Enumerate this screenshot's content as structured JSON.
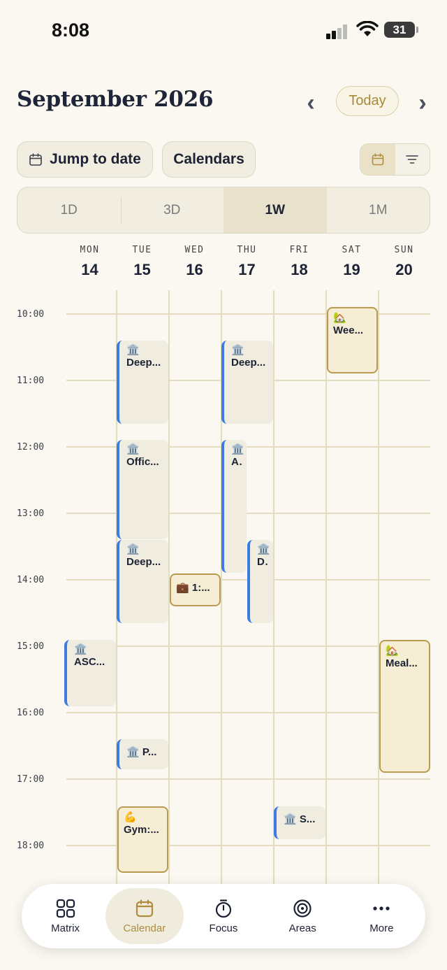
{
  "status": {
    "time": "8:08",
    "battery": "31"
  },
  "header": {
    "title": "September 2026",
    "today_label": "Today",
    "prev": "‹",
    "next": "›"
  },
  "toolbar": {
    "jump_label": "Jump to date",
    "calendars_label": "Calendars"
  },
  "range": {
    "options": [
      "1D",
      "3D",
      "1W",
      "1M"
    ],
    "selected": "1W"
  },
  "days": [
    {
      "dow": "MON",
      "num": "14"
    },
    {
      "dow": "TUE",
      "num": "15"
    },
    {
      "dow": "WED",
      "num": "16"
    },
    {
      "dow": "THU",
      "num": "17"
    },
    {
      "dow": "FRI",
      "num": "18"
    },
    {
      "dow": "SAT",
      "num": "19"
    },
    {
      "dow": "SUN",
      "num": "20"
    }
  ],
  "hours": [
    "10:00",
    "11:00",
    "12:00",
    "13:00",
    "14:00",
    "15:00",
    "16:00",
    "17:00",
    "18:00"
  ],
  "events": {
    "sat_wee": {
      "icon": "🏡",
      "label": "Wee..."
    },
    "tue_deep1": {
      "icon": "🏛️",
      "label": "Deep..."
    },
    "thu_deep": {
      "icon": "🏛️",
      "label": "Deep..."
    },
    "tue_office": {
      "icon": "🏛️",
      "label": "Offic..."
    },
    "thu_a": {
      "icon": "🏛️",
      "label": "A..."
    },
    "tue_deep2": {
      "icon": "🏛️",
      "label": "Deep..."
    },
    "thu_d": {
      "icon": "🏛️",
      "label": "D..."
    },
    "wed_one": {
      "icon": "💼",
      "label": "1:..."
    },
    "mon_asc": {
      "icon": "🏛️",
      "label": "ASC..."
    },
    "sun_meal": {
      "icon": "🏡",
      "label": "Meal..."
    },
    "tue_p": {
      "icon": "🏛️",
      "label": "P..."
    },
    "tue_gym": {
      "icon": "💪",
      "label": "Gym:..."
    },
    "fri_s": {
      "icon": "🏛️",
      "label": "S..."
    }
  },
  "colors": {
    "accent": "#B08D3D",
    "blue_event": "#3C7BE0",
    "background": "#FAF8F0"
  },
  "tabs": [
    {
      "label": "Matrix",
      "icon": "grid-icon"
    },
    {
      "label": "Calendar",
      "icon": "calendar-icon"
    },
    {
      "label": "Focus",
      "icon": "timer-icon"
    },
    {
      "label": "Areas",
      "icon": "target-icon"
    },
    {
      "label": "More",
      "icon": "more-icon"
    }
  ]
}
